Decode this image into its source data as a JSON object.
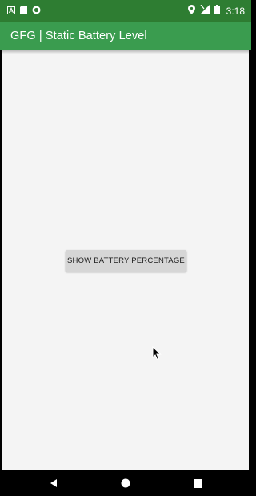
{
  "status_bar": {
    "time": "3:18",
    "left_icons": [
      "notification-a-icon",
      "sd-card-icon",
      "sync-circle-icon"
    ],
    "right_icons": [
      "location-pin-icon",
      "signal-no-data-icon",
      "battery-icon"
    ]
  },
  "app_bar": {
    "title": "GFG | Static Battery Level",
    "color": "#3a9c4f"
  },
  "main": {
    "button_label": "SHOW BATTERY PERCENTAGE"
  },
  "nav_bar": {
    "icons": [
      "back-icon",
      "home-icon",
      "recents-icon"
    ]
  },
  "colors": {
    "status_bar": "#2e7d32",
    "app_bar": "#3a9c4f",
    "background": "#f4f4f4",
    "button": "#d6d6d6"
  }
}
